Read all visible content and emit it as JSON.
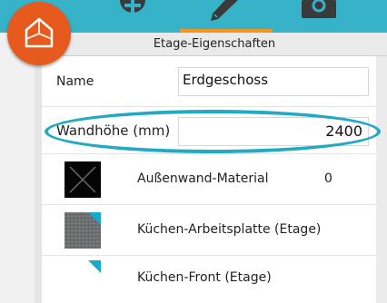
{
  "toolbar": {
    "tools": [
      {
        "icon": "plus-circle-icon"
      },
      {
        "icon": "pencil-icon",
        "active": true
      },
      {
        "icon": "camera-icon"
      }
    ],
    "colors": {
      "bar": "#36b3c8",
      "active_indicator": "#f7941d"
    }
  },
  "logo": {
    "icon": "house-3d-icon",
    "color": "#e65a1e"
  },
  "panel": {
    "title": "Etage-Eigenschaften",
    "name": {
      "label": "Name",
      "value": "Erdgeschoss"
    },
    "wall_height": {
      "label": "Wandhöhe (mm)",
      "value": "2400"
    },
    "materials": [
      {
        "label": "Außenwand-Material",
        "value": "0",
        "icon": "black-crossed-swatch-icon"
      },
      {
        "label": "Küchen-Arbeitsplatte (Etage)",
        "value": "",
        "icon": "grey-stone-swatch-icon"
      },
      {
        "label": "Küchen-Front (Etage)",
        "value": "",
        "icon": "white-swatch-icon"
      }
    ],
    "highlight_color": "#22a9c4"
  }
}
